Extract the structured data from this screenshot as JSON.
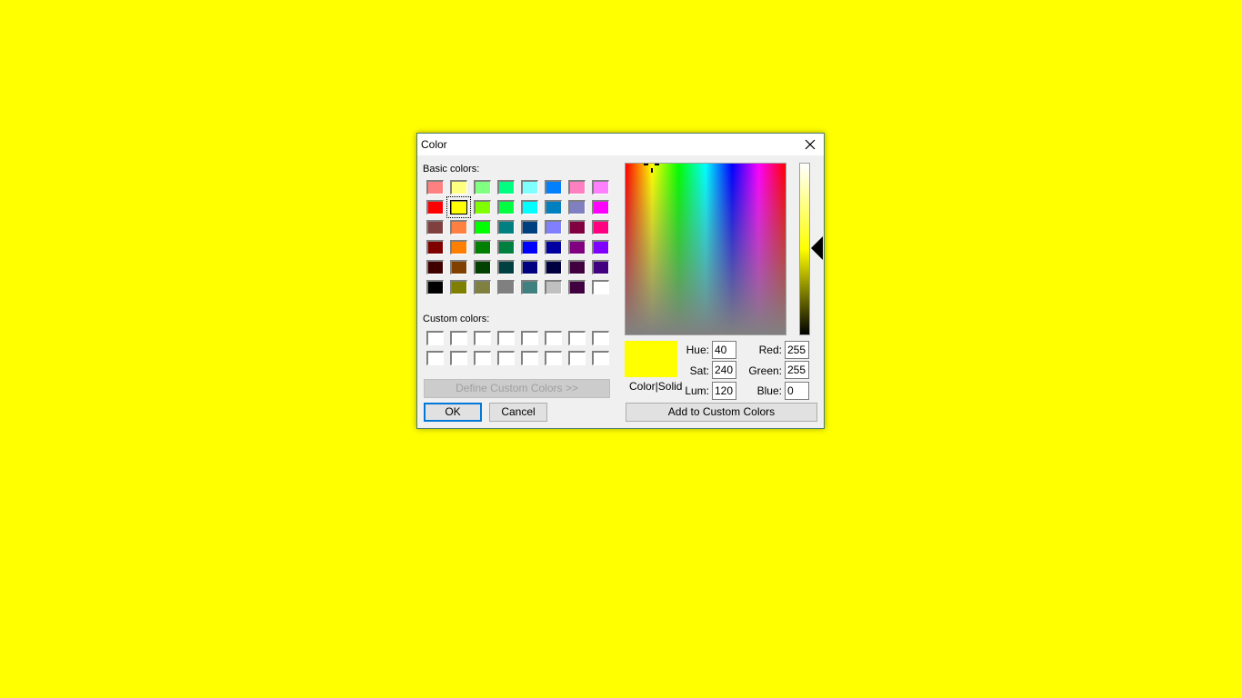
{
  "desktop": {
    "background_color": "#ffff00"
  },
  "dialog": {
    "title": "Color",
    "close_icon": "close-icon",
    "basic_colors_label": "Basic colors:",
    "basic_colors": [
      [
        "#ff8080",
        "#ffff80",
        "#80ff80",
        "#00ff80",
        "#80ffff",
        "#0080ff",
        "#ff80c0",
        "#ff80ff"
      ],
      [
        "#ff0000",
        "#ffff00",
        "#80ff00",
        "#00ff40",
        "#00ffff",
        "#0080c0",
        "#8080c0",
        "#ff00ff"
      ],
      [
        "#804040",
        "#ff8040",
        "#00ff00",
        "#008080",
        "#004080",
        "#8080ff",
        "#800040",
        "#ff0080"
      ],
      [
        "#800000",
        "#ff8000",
        "#008000",
        "#008040",
        "#0000ff",
        "#0000a0",
        "#800080",
        "#8000ff"
      ],
      [
        "#400000",
        "#804000",
        "#004000",
        "#004040",
        "#000080",
        "#000040",
        "#400040",
        "#400080"
      ],
      [
        "#000000",
        "#808000",
        "#808040",
        "#808080",
        "#408080",
        "#c0c0c0",
        "#400040",
        "#ffffff"
      ]
    ],
    "selected_basic": {
      "row": 1,
      "col": 1
    },
    "custom_colors_label": "Custom colors:",
    "custom_colors": [
      [
        "#ffffff",
        "#ffffff",
        "#ffffff",
        "#ffffff",
        "#ffffff",
        "#ffffff",
        "#ffffff",
        "#ffffff"
      ],
      [
        "#ffffff",
        "#ffffff",
        "#ffffff",
        "#ffffff",
        "#ffffff",
        "#ffffff",
        "#ffffff",
        "#ffffff"
      ]
    ],
    "define_custom_label": "Define Custom Colors >>",
    "ok_label": "OK",
    "cancel_label": "Cancel",
    "preview_label": "Color|Solid",
    "preview_color": "#ffff00",
    "hue_label": "Hue:",
    "hue_value": "40",
    "sat_label": "Sat:",
    "sat_value": "240",
    "lum_label": "Lum:",
    "lum_value": "120",
    "red_label": "Red:",
    "red_value": "255",
    "green_label": "Green:",
    "green_value": "255",
    "blue_label": "Blue:",
    "blue_value": "0",
    "add_custom_label": "Add to Custom Colors"
  }
}
